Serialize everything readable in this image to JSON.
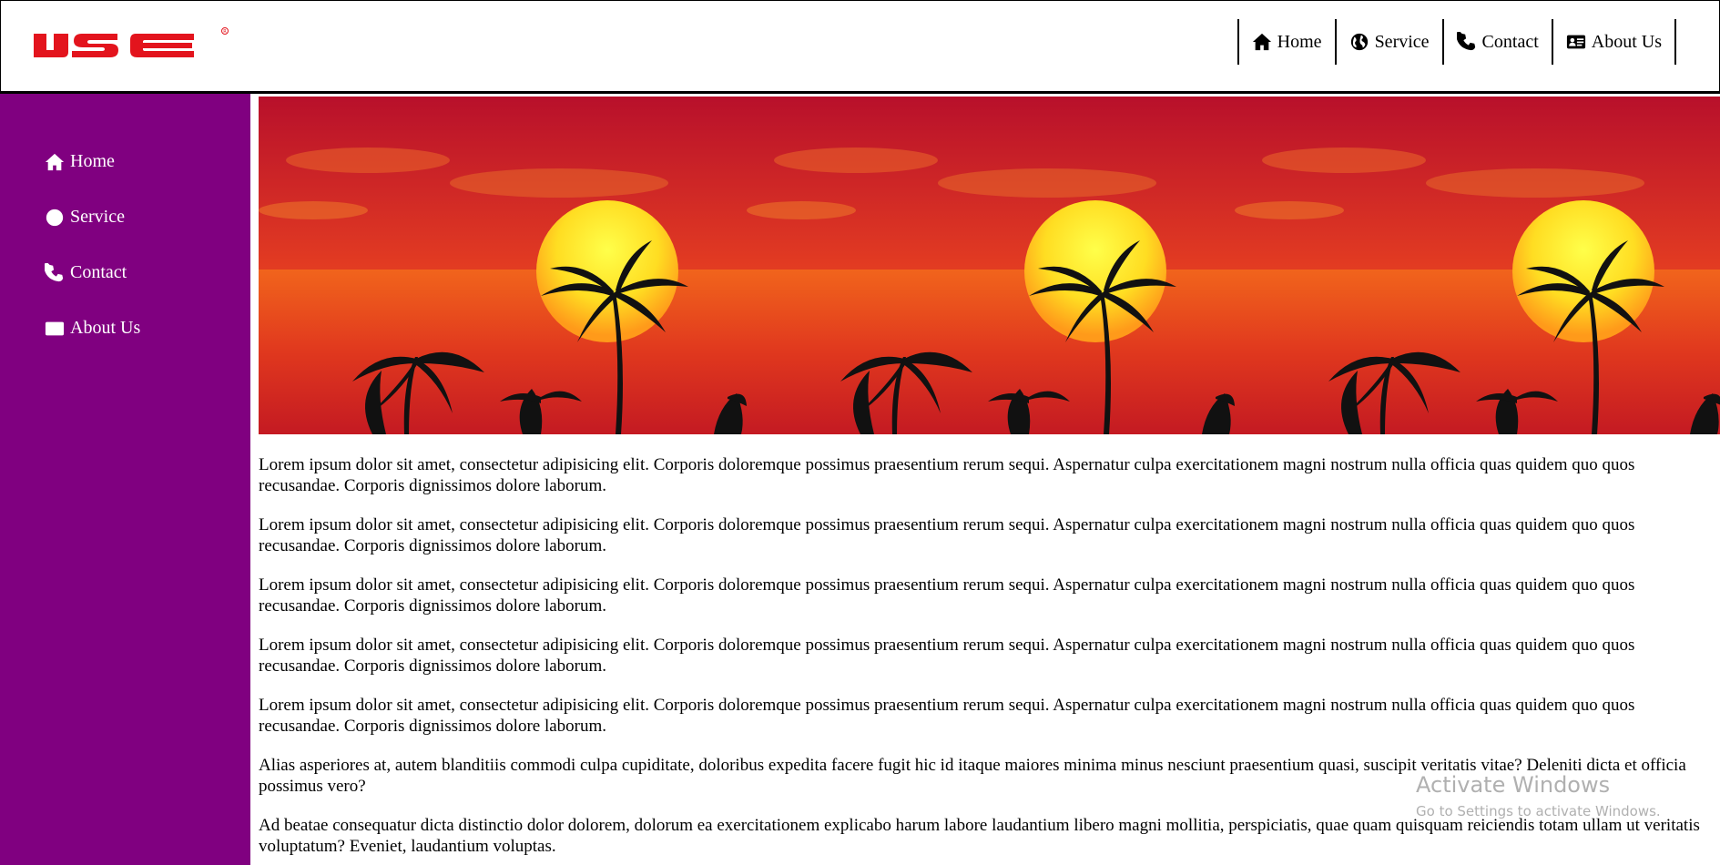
{
  "header": {
    "logo_text": "IJSE",
    "brand_color": "#e3141d",
    "nav": [
      {
        "label": "Home",
        "icon": "home-icon"
      },
      {
        "label": "Service",
        "icon": "globe-icon"
      },
      {
        "label": "Contact",
        "icon": "phone-icon"
      },
      {
        "label": "About Us",
        "icon": "id-card-icon"
      }
    ]
  },
  "sidebar": {
    "background": "#800080",
    "items": [
      {
        "label": "Home",
        "icon": "home-icon"
      },
      {
        "label": "Service",
        "icon": "globe-icon"
      },
      {
        "label": "Contact",
        "icon": "phone-icon"
      },
      {
        "label": "About Us",
        "icon": "id-card-icon"
      }
    ]
  },
  "main": {
    "banner_images": [
      "sunset-palm-image",
      "sunset-palm-image",
      "sunset-palm-image"
    ],
    "paragraphs": [
      "Lorem ipsum dolor sit amet, consectetur adipisicing elit. Corporis doloremque possimus praesentium rerum sequi. Aspernatur culpa exercitationem magni nostrum nulla officia quas quidem quo quos recusandae. Corporis dignissimos dolore laborum.",
      "Lorem ipsum dolor sit amet, consectetur adipisicing elit. Corporis doloremque possimus praesentium rerum sequi. Aspernatur culpa exercitationem magni nostrum nulla officia quas quidem quo quos recusandae. Corporis dignissimos dolore laborum.",
      "Lorem ipsum dolor sit amet, consectetur adipisicing elit. Corporis doloremque possimus praesentium rerum sequi. Aspernatur culpa exercitationem magni nostrum nulla officia quas quidem quo quos recusandae. Corporis dignissimos dolore laborum.",
      "Lorem ipsum dolor sit amet, consectetur adipisicing elit. Corporis doloremque possimus praesentium rerum sequi. Aspernatur culpa exercitationem magni nostrum nulla officia quas quidem quo quos recusandae. Corporis dignissimos dolore laborum.",
      "Lorem ipsum dolor sit amet, consectetur adipisicing elit. Corporis doloremque possimus praesentium rerum sequi. Aspernatur culpa exercitationem magni nostrum nulla officia quas quidem quo quos recusandae. Corporis dignissimos dolore laborum.",
      "Alias asperiores at, autem blanditiis commodi culpa cupiditate, doloribus expedita facere fugit hic id itaque maiores minima minus nesciunt praesentium quasi, suscipit veritatis vitae? Deleniti dicta et officia possimus vero?",
      "Ad beatae consequatur dicta distinctio dolor dolorem, dolorum ea exercitationem explicabo harum labore laudantium libero magni mollitia, perspiciatis, quae quam quisquam reiciendis totam ullam ut veritatis voluptatum? Eveniet, laudantium voluptas."
    ]
  },
  "watermark": {
    "title": "Activate Windows",
    "subtitle": "Go to Settings to activate Windows."
  }
}
